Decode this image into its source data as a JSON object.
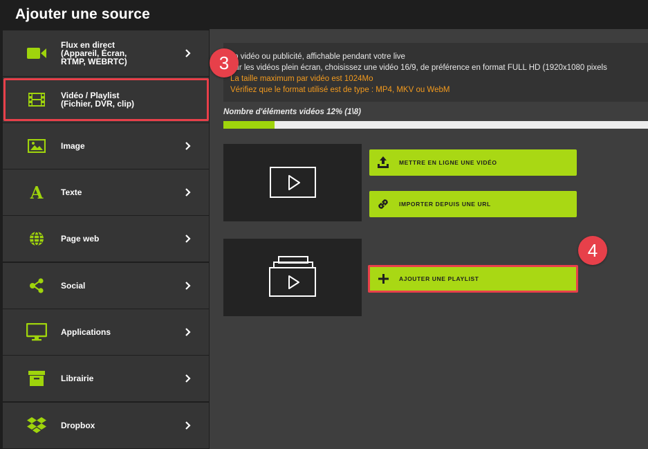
{
  "header": {
    "title": "Ajouter une source"
  },
  "sidebar": {
    "items": [
      {
        "label": "Flux en direct\n(Appareil, Écran,\nRTMP, WEBRTC)",
        "icon": "camera-icon"
      },
      {
        "label": "Vidéo / Playlist\n(Fichier, DVR, clip)",
        "icon": "film-icon"
      },
      {
        "label": "Image",
        "icon": "image-icon"
      },
      {
        "label": "Texte",
        "icon": "text-icon"
      },
      {
        "label": "Page web",
        "icon": "globe-icon"
      },
      {
        "label": "Social",
        "icon": "share-icon"
      },
      {
        "label": "Applications",
        "icon": "monitor-icon"
      },
      {
        "label": "Librairie",
        "icon": "archive-icon"
      },
      {
        "label": "Dropbox",
        "icon": "dropbox-icon"
      }
    ]
  },
  "info": {
    "line1": "lip vidéo ou publicité, affichable pendant votre live",
    "line2": "our les vidéos plein écran, choisissez une vidéo 16/9, de préférence en format FULL HD (1920x1080 pixels",
    "line3": "La taille maximum par vidéo est 1024Mo",
    "line4": "Vérifiez que le format utilisé est de type : MP4, MKV ou WebM"
  },
  "progress": {
    "label": "Nombre d'éléments vidéos 12% (1\\8)",
    "percent": 12
  },
  "buttons": {
    "upload": "METTRE EN LIGNE UNE VIDÉO",
    "import_url": "IMPORTER DEPUIS UNE URL",
    "add_playlist": "AJOUTER UNE PLAYLIST"
  },
  "annotations": {
    "step3": "3",
    "step4": "4"
  },
  "colors": {
    "accent": "#a9d814",
    "highlight": "#e8404a",
    "info_orange": "#f29a1e"
  }
}
